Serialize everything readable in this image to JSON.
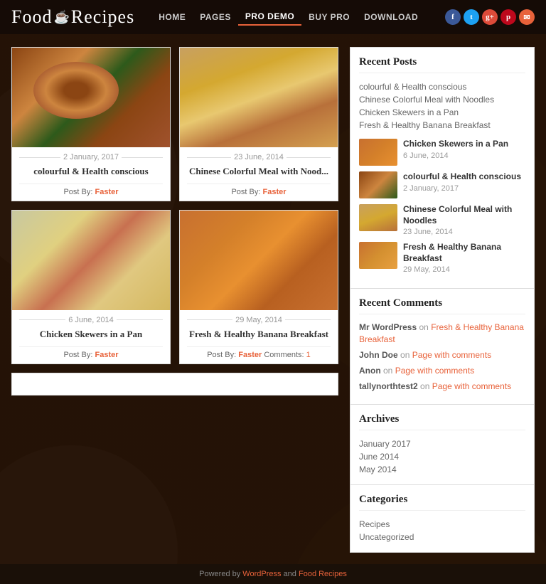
{
  "header": {
    "logo_food": "Food",
    "logo_recipes": "Recipes",
    "logo_icon": "☕",
    "nav": [
      {
        "label": "HOME",
        "active": false
      },
      {
        "label": "PAGES",
        "active": false
      },
      {
        "label": "PRO DEMO",
        "active": true
      },
      {
        "label": "BUY PRO",
        "active": false
      },
      {
        "label": "DOWNLOAD",
        "active": false
      }
    ],
    "social": [
      {
        "label": "f",
        "class": "si-fb",
        "name": "facebook"
      },
      {
        "label": "t",
        "class": "si-tw",
        "name": "twitter"
      },
      {
        "label": "g+",
        "class": "si-gp",
        "name": "google-plus"
      },
      {
        "label": "p",
        "class": "si-pi",
        "name": "pinterest"
      },
      {
        "label": "✉",
        "class": "si-em",
        "name": "email"
      }
    ]
  },
  "posts": [
    {
      "id": 1,
      "date": "2 January, 2017",
      "title": "colourful & Health conscious",
      "author": "Faster",
      "comments": null,
      "img_class": "food-img-1"
    },
    {
      "id": 2,
      "date": "23 June, 2014",
      "title": "Chinese Colorful Meal with Nood...",
      "author": "Faster",
      "comments": null,
      "img_class": "food-img-2"
    },
    {
      "id": 3,
      "date": "6 June, 2014",
      "title": "Chicken Skewers in a Pan",
      "author": "Faster",
      "comments": null,
      "img_class": "food-img-3"
    },
    {
      "id": 4,
      "date": "29 May, 2014",
      "title": "Fresh & Healthy Banana Breakfast",
      "author": "Faster",
      "comments": "1",
      "img_class": "food-img-4"
    }
  ],
  "post_by_label": "Post By:",
  "comments_label": "Comments:",
  "sidebar": {
    "recent_posts_title": "Recent Posts",
    "recent_posts_links": [
      "colourful & Health conscious",
      "Chinese Colorful Meal with Noodles",
      "Chicken Skewers in a Pan",
      "Fresh & Healthy Banana Breakfast"
    ],
    "recent_posts_thumbs": [
      {
        "title": "Chicken Skewers in a Pan",
        "date": "6 June, 2014",
        "img_class": "thumb-food-1"
      },
      {
        "title": "colourful & Health conscious",
        "date": "2 January, 2017",
        "img_class": "thumb-food-2"
      },
      {
        "title": "Chinese Colorful Meal with Noodles",
        "date": "23 June, 2014",
        "img_class": "thumb-food-3"
      },
      {
        "title": "Fresh & Healthy Banana Breakfast",
        "date": "29 May, 2014",
        "img_class": "thumb-food-4"
      }
    ],
    "recent_comments_title": "Recent Comments",
    "comments": [
      {
        "author": "Mr WordPress",
        "on_text": "on",
        "link": "Fresh & Healthy Banana Breakfast"
      },
      {
        "author": "John Doe",
        "on_text": "on",
        "link": "Page with comments"
      },
      {
        "author": "Anon",
        "on_text": "on",
        "link": "Page with comments"
      },
      {
        "author": "tallynorthtest2",
        "on_text": "on",
        "link": "Page with comments"
      }
    ],
    "archives_title": "Archives",
    "archives": [
      "January 2017",
      "June 2014",
      "May 2014"
    ],
    "categories_title": "Categories",
    "categories": [
      "Recipes",
      "Uncategorized"
    ]
  },
  "footer": {
    "text": "Powered by ",
    "link1": "WordPress",
    "and": " and ",
    "link2": "Food Recipes"
  }
}
